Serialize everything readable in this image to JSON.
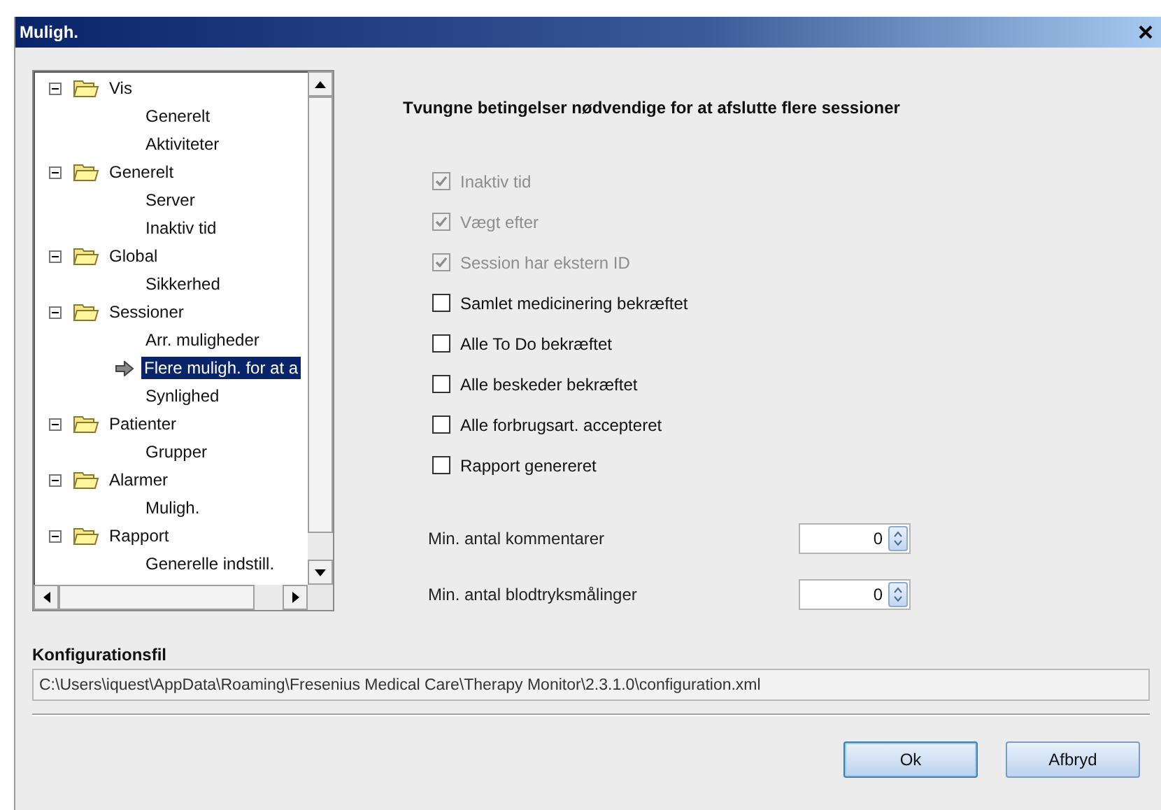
{
  "window": {
    "title": "Muligh."
  },
  "tree": [
    {
      "label": "Vis",
      "expanded": true,
      "children": [
        {
          "label": "Generelt",
          "selected": false
        },
        {
          "label": "Aktiviteter",
          "selected": false
        }
      ]
    },
    {
      "label": "Generelt",
      "expanded": true,
      "children": [
        {
          "label": "Server",
          "selected": false
        },
        {
          "label": "Inaktiv tid",
          "selected": false
        }
      ]
    },
    {
      "label": "Global",
      "expanded": true,
      "children": [
        {
          "label": "Sikkerhed",
          "selected": false
        }
      ]
    },
    {
      "label": "Sessioner",
      "expanded": true,
      "children": [
        {
          "label": "Arr. muligheder",
          "selected": false
        },
        {
          "label": "Flere muligh. for at a",
          "selected": true
        },
        {
          "label": "Synlighed",
          "selected": false
        }
      ]
    },
    {
      "label": "Patienter",
      "expanded": true,
      "children": [
        {
          "label": "Grupper",
          "selected": false
        }
      ]
    },
    {
      "label": "Alarmer",
      "expanded": true,
      "children": [
        {
          "label": "Muligh.",
          "selected": false
        }
      ]
    },
    {
      "label": "Rapport",
      "expanded": true,
      "children": [
        {
          "label": "Generelle indstill.",
          "selected": false
        }
      ]
    }
  ],
  "panel": {
    "heading": "Tvungne betingelser nødvendige for at afslutte flere sessioner",
    "checkboxes": [
      {
        "label": "Inaktiv tid",
        "checked": true,
        "disabled": true
      },
      {
        "label": "Vægt efter",
        "checked": true,
        "disabled": true
      },
      {
        "label": "Session har ekstern ID",
        "checked": true,
        "disabled": true
      },
      {
        "label": "Samlet medicinering bekræftet",
        "checked": false,
        "disabled": false
      },
      {
        "label": "Alle To Do bekræftet",
        "checked": false,
        "disabled": false
      },
      {
        "label": "Alle beskeder bekræftet",
        "checked": false,
        "disabled": false
      },
      {
        "label": "Alle forbrugsart. accepteret",
        "checked": false,
        "disabled": false
      },
      {
        "label": "Rapport genereret",
        "checked": false,
        "disabled": false
      }
    ],
    "spinners": [
      {
        "label": "Min. antal kommentarer",
        "value": "0"
      },
      {
        "label": "Min. antal blodtryksmålinger",
        "value": "0"
      }
    ]
  },
  "config": {
    "label": "Konfigurationsfil",
    "path": "C:\\Users\\iquest\\AppData\\Roaming\\Fresenius Medical Care\\Therapy Monitor\\2.3.1.0\\configuration.xml"
  },
  "buttons": [
    "Ok",
    "Afbryd"
  ]
}
